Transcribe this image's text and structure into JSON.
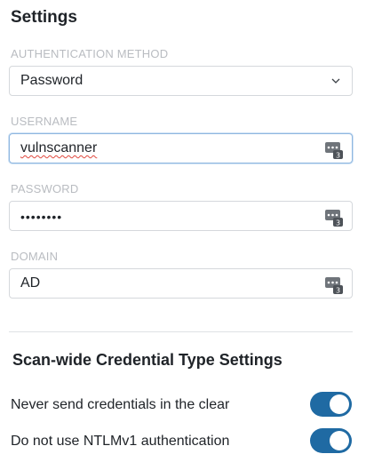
{
  "page_title": "Settings",
  "auth_method": {
    "label": "AUTHENTICATION METHOD",
    "value": "Password",
    "icon": "chevron-down-icon"
  },
  "username": {
    "label": "USERNAME",
    "value": "vulnscanner",
    "icon": "password-manager-key-icon"
  },
  "password": {
    "label": "PASSWORD",
    "value": "••••••••",
    "icon": "password-manager-key-icon"
  },
  "domain": {
    "label": "DOMAIN",
    "value": "AD",
    "icon": "password-manager-key-icon"
  },
  "scan_wide": {
    "title": "Scan-wide Credential Type Settings",
    "toggles": [
      {
        "label": "Never send credentials in the clear",
        "on": true
      },
      {
        "label": "Do not use NTLMv1 authentication",
        "on": true
      }
    ]
  },
  "colors": {
    "toggle_on": "#1f6aa3",
    "label_muted": "#b9bcc1",
    "field_border": "#d5d8dc"
  }
}
